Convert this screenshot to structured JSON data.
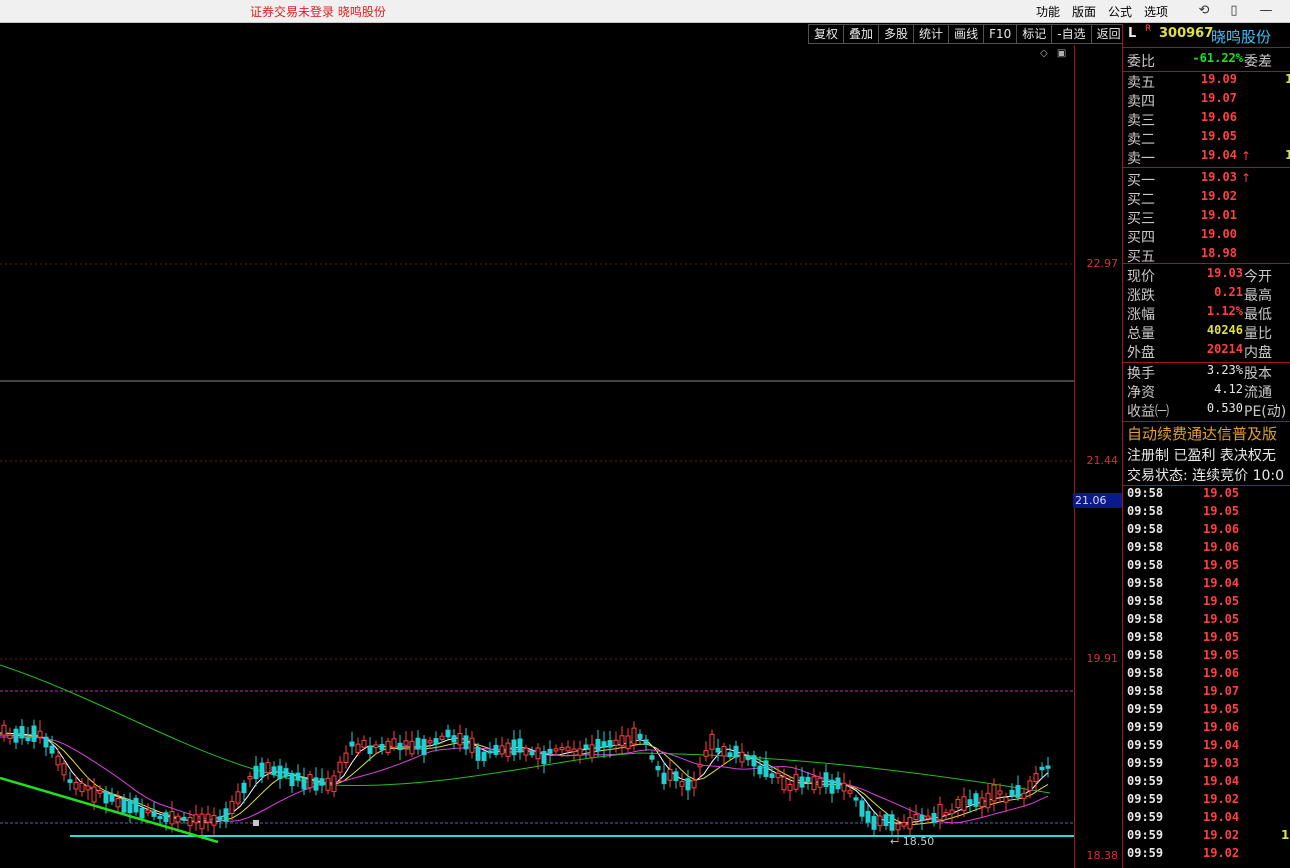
{
  "window": {
    "login_warning": "证券交易未登录   晓鸣股份",
    "menu": [
      "功能",
      "版面",
      "公式",
      "选项"
    ]
  },
  "toolbar": [
    "复权",
    "叠加",
    "多股",
    "统计",
    "画线",
    "F10",
    "标记",
    "-自选",
    "返回"
  ],
  "axis": {
    "labels": [
      "22.97",
      "21.44",
      "19.91",
      "18.38"
    ],
    "current_price_tag": "21.06",
    "low_marker": "18.50"
  },
  "stock": {
    "flag_l": "L",
    "flag_r": "R",
    "code": "300967",
    "name": "晓鸣股份"
  },
  "bid_ask": {
    "weibi_label": "委比",
    "weibi_value": "-61.22%",
    "weicha_label": "委差",
    "sell": [
      {
        "label": "卖五",
        "price": "19.09",
        "vol": "1"
      },
      {
        "label": "卖四",
        "price": "19.07",
        "vol": ""
      },
      {
        "label": "卖三",
        "price": "19.06",
        "vol": ""
      },
      {
        "label": "卖二",
        "price": "19.05",
        "vol": ""
      },
      {
        "label": "卖一",
        "price": "19.04",
        "vol": "1"
      }
    ],
    "buy": [
      {
        "label": "买一",
        "price": "19.03",
        "vol": ""
      },
      {
        "label": "买二",
        "price": "19.02",
        "vol": ""
      },
      {
        "label": "买三",
        "price": "19.01",
        "vol": ""
      },
      {
        "label": "买四",
        "price": "19.00",
        "vol": ""
      },
      {
        "label": "买五",
        "price": "18.98",
        "vol": ""
      }
    ]
  },
  "quote": [
    {
      "label": "现价",
      "value": "19.03",
      "color": "red",
      "label2": "今开"
    },
    {
      "label": "涨跌",
      "value": "0.21",
      "color": "red",
      "label2": "最高"
    },
    {
      "label": "涨幅",
      "value": "1.12%",
      "color": "red",
      "label2": "最低"
    },
    {
      "label": "总量",
      "value": "40246",
      "color": "yellow",
      "label2": "量比"
    },
    {
      "label": "外盘",
      "value": "20214",
      "color": "red",
      "label2": "内盘"
    }
  ],
  "fundamentals": [
    {
      "label": "换手",
      "value": "3.23%",
      "label2": "股本"
    },
    {
      "label": "净资",
      "value": "4.12",
      "label2": "流通"
    },
    {
      "label": "收益㈠",
      "value": "0.530",
      "label2": "PE(动)"
    }
  ],
  "notice": {
    "ad": "自动续费通达信普及版",
    "tags": "注册制 已盈利 表决权无",
    "status": "交易状态: 连续竞价 10:0"
  },
  "ticks": [
    {
      "time": "09:58",
      "price": "19.05",
      "vol": ""
    },
    {
      "time": "09:58",
      "price": "19.05",
      "vol": ""
    },
    {
      "time": "09:58",
      "price": "19.06",
      "vol": ""
    },
    {
      "time": "09:58",
      "price": "19.06",
      "vol": ""
    },
    {
      "time": "09:58",
      "price": "19.05",
      "vol": ""
    },
    {
      "time": "09:58",
      "price": "19.04",
      "vol": ""
    },
    {
      "time": "09:58",
      "price": "19.05",
      "vol": ""
    },
    {
      "time": "09:58",
      "price": "19.05",
      "vol": ""
    },
    {
      "time": "09:58",
      "price": "19.05",
      "vol": ""
    },
    {
      "time": "09:58",
      "price": "19.05",
      "vol": ""
    },
    {
      "time": "09:58",
      "price": "19.06",
      "vol": ""
    },
    {
      "time": "09:58",
      "price": "19.07",
      "vol": ""
    },
    {
      "time": "09:59",
      "price": "19.05",
      "vol": ""
    },
    {
      "time": "09:59",
      "price": "19.06",
      "vol": ""
    },
    {
      "time": "09:59",
      "price": "19.04",
      "vol": ""
    },
    {
      "time": "09:59",
      "price": "19.03",
      "vol": ""
    },
    {
      "time": "09:59",
      "price": "19.04",
      "vol": ""
    },
    {
      "time": "09:59",
      "price": "19.02",
      "vol": ""
    },
    {
      "time": "09:59",
      "price": "19.04",
      "vol": ""
    },
    {
      "time": "09:59",
      "price": "19.02",
      "vol": "1"
    },
    {
      "time": "09:59",
      "price": "19.02",
      "vol": ""
    }
  ],
  "colors": {
    "up": "#ff4040",
    "down": "#20d0d0",
    "ma5": "#ffffff",
    "ma10": "#e0e040",
    "ma20": "#e040e0",
    "ma60": "#20c020",
    "support": "#20e0e0",
    "trend": "#20e020"
  }
}
